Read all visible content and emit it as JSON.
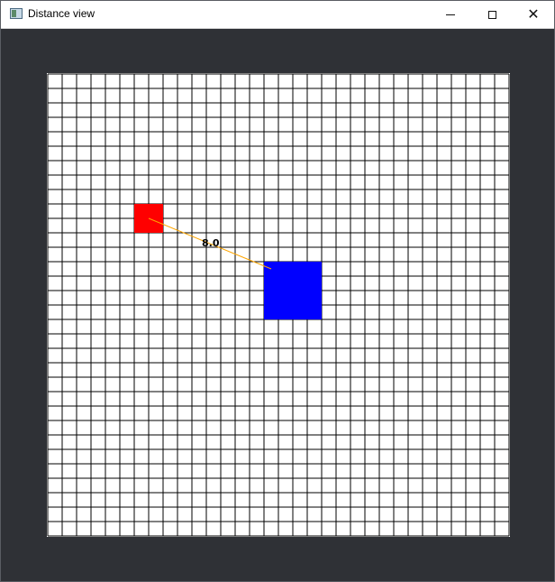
{
  "window": {
    "title": "Distance view",
    "controls": {
      "minimize_icon": "minimize-icon",
      "maximize_icon": "maximize-icon",
      "close_icon": "close-icon",
      "close_glyph": "✕"
    }
  },
  "scene": {
    "background_color": "#2f3136",
    "grid": {
      "columns": 32,
      "rows": 32,
      "cell_color": "#ffffff",
      "line_color": "#000000"
    },
    "objects": [
      {
        "name": "red-square",
        "color": "#ff0000",
        "cell": [
          6,
          9
        ],
        "span": 2
      },
      {
        "name": "blue-square",
        "color": "#0000ff",
        "cell": [
          15,
          13
        ],
        "span": 4
      }
    ],
    "connector": {
      "color": "#ffa500",
      "from": [
        7,
        10
      ],
      "to": [
        15.5,
        13.5
      ],
      "label": "8.0"
    }
  }
}
